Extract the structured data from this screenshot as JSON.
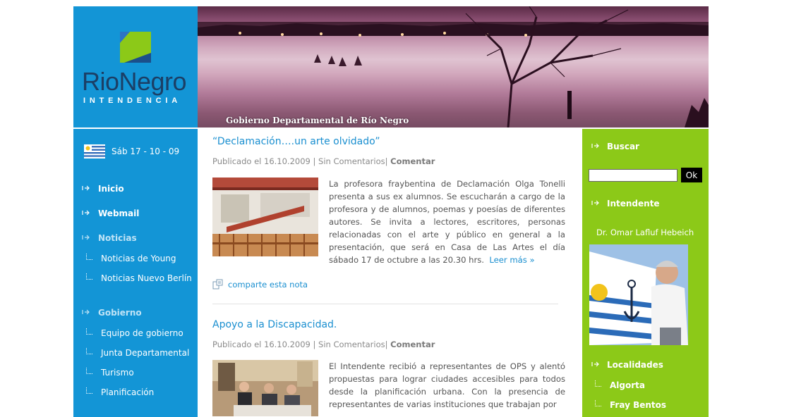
{
  "header": {
    "logo_title": "RioNegro",
    "logo_subtitle": "INTENDENCIA",
    "banner_caption": "Gobierno Departamental de Río Negro"
  },
  "left_sidebar": {
    "date": "Sáb 17 - 10 - 09",
    "nav": [
      {
        "label": "Inicio"
      },
      {
        "label": "Webmail"
      },
      {
        "label": "Noticias"
      },
      {
        "label": "Gobierno"
      }
    ],
    "noticias_sub": [
      {
        "label": "Noticias de Young"
      },
      {
        "label": "Noticias Nuevo Berlín"
      }
    ],
    "gobierno_sub": [
      {
        "label": "Equipo de gobierno"
      },
      {
        "label": "Junta Departamental"
      },
      {
        "label": "Turismo"
      },
      {
        "label": "Planificación"
      }
    ]
  },
  "posts": [
    {
      "title": "“Declamación….un arte olvidado”",
      "meta_prefix": "Publicado el 16.10.2009 | Sin Comentarios| ",
      "meta_action": "Comentar",
      "body": "La profesora fraybentina de Declamación Olga Tonelli presenta a sus ex alumnos.  Se escucharán  a cargo de la profesora y de alumnos, poemas y poesías de diferentes autores. Se invita a lectores, escritores, personas relacionadas con el arte y  público en general a la presentación, que será en Casa de Las Artes el día sábado 17 de octubre a las 20.30 hrs.",
      "read_more": "Leer más »",
      "share": "comparte esta nota"
    },
    {
      "title": "Apoyo a la Discapacidad.",
      "meta_prefix": "Publicado el 16.10.2009 | Sin Comentarios| ",
      "meta_action": "Comentar",
      "body": "El Intendente recibió a representantes de OPS y alentó propuestas para lograr ciudades accesibles para todos desde la planificación urbana. Con la presencia de representantes de varias instituciones que trabajan por"
    }
  ],
  "right_sidebar": {
    "search_heading": "Buscar",
    "search_button": "Ok",
    "search_value": "",
    "intendente_heading": "Intendente",
    "intendente_name": "Dr. Omar Lafluf Hebeich",
    "localidades_heading": "Localidades",
    "localidades": [
      {
        "label": "Algorta"
      },
      {
        "label": "Fray Bentos"
      }
    ]
  },
  "colors": {
    "left_blue": "#1395d6",
    "right_green": "#8cc918",
    "link_blue": "#1a8fd0",
    "logo_navy": "#1b3f66"
  }
}
